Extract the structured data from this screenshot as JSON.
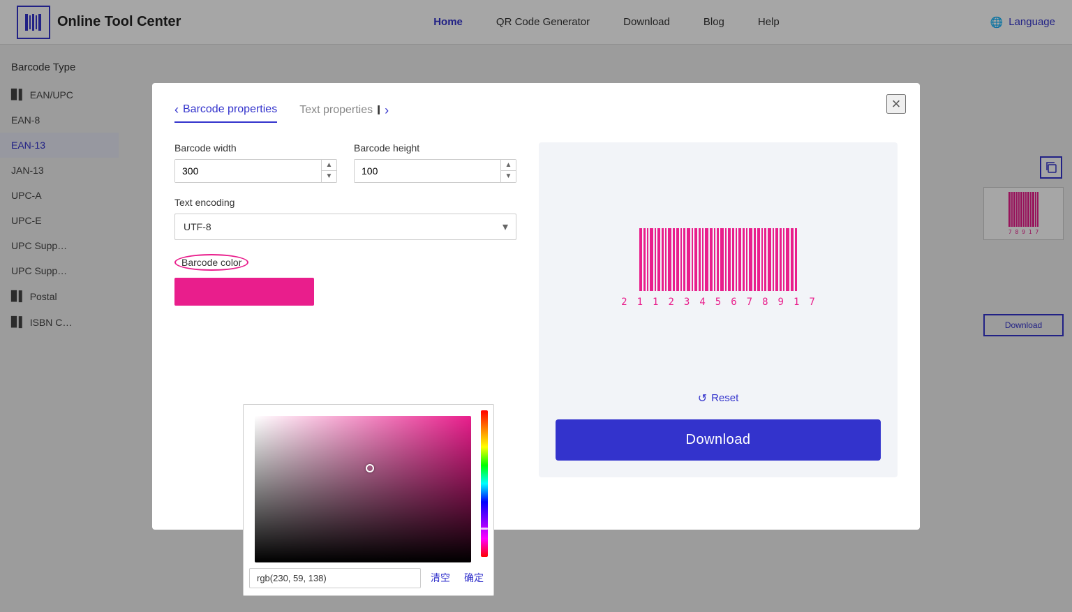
{
  "nav": {
    "logo_text": "Online Tool Center",
    "links": [
      {
        "label": "Home",
        "active": true
      },
      {
        "label": "QR Code Generator",
        "active": false
      },
      {
        "label": "Download",
        "active": false
      },
      {
        "label": "Blog",
        "active": false
      },
      {
        "label": "Help",
        "active": false
      }
    ],
    "language_label": "Language"
  },
  "sidebar": {
    "title": "Barcode Type",
    "items": [
      {
        "label": "EAN/UPC",
        "icon": "▊▊",
        "active": false
      },
      {
        "label": "EAN-8",
        "active": false
      },
      {
        "label": "EAN-13",
        "active": true
      },
      {
        "label": "JAN-13",
        "active": false
      },
      {
        "label": "UPC-A",
        "active": false
      },
      {
        "label": "UPC-E",
        "active": false
      },
      {
        "label": "UPC Supp…",
        "active": false
      },
      {
        "label": "UPC Supp…",
        "active": false
      },
      {
        "label": "Postal",
        "icon": "▊▊",
        "active": false
      },
      {
        "label": "ISBN C…",
        "icon": "▊▊",
        "active": false
      }
    ]
  },
  "modal": {
    "tab_barcode": "Barcode properties",
    "tab_text": "Text properties",
    "close_label": "×",
    "barcode_width_label": "Barcode width",
    "barcode_width_value": "300",
    "barcode_height_label": "Barcode height",
    "barcode_height_value": "100",
    "encoding_label": "Text encoding",
    "encoding_value": "UTF-8",
    "color_label": "Barcode color",
    "color_value": "rgb(230, 59, 138)",
    "clear_btn": "清空",
    "confirm_btn": "确定",
    "reset_label": "Reset",
    "download_label": "Download",
    "barcode_numbers": [
      "2",
      "1",
      "1",
      "2",
      "3",
      "4",
      "5",
      "6",
      "7",
      "8",
      "9",
      "1",
      "7"
    ]
  },
  "colors": {
    "accent": "#3333cc",
    "barcode_color": "#e91e8c",
    "download_bg": "#3333cc"
  }
}
